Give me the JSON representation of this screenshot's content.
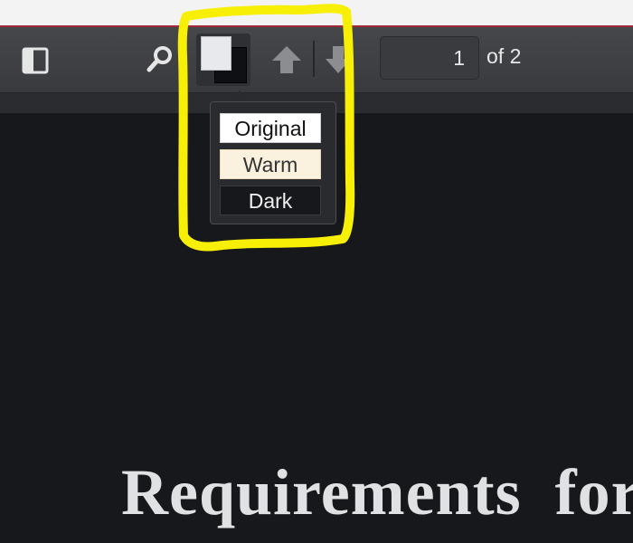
{
  "toolbar": {
    "sidebar_icon": "sidebar-toggle-icon",
    "search_icon": "search-icon",
    "theme_icon": "theme-swatch-icon",
    "prev_icon": "arrow-up-icon",
    "next_icon": "arrow-down-icon",
    "page_number": "1",
    "page_count_label": "of 2"
  },
  "theme_menu": {
    "options": [
      {
        "label": "Original",
        "bg": "#ffffff"
      },
      {
        "label": "Warm",
        "bg": "#fbf1df"
      },
      {
        "label": "Dark",
        "bg": "#17181c"
      }
    ]
  },
  "document": {
    "title": "Requirements for"
  },
  "colors": {
    "toolbar_bg": "#3f4044",
    "page_bg": "#17181c",
    "highlight": "#f7ef05",
    "accent_line": "#a12a39"
  }
}
